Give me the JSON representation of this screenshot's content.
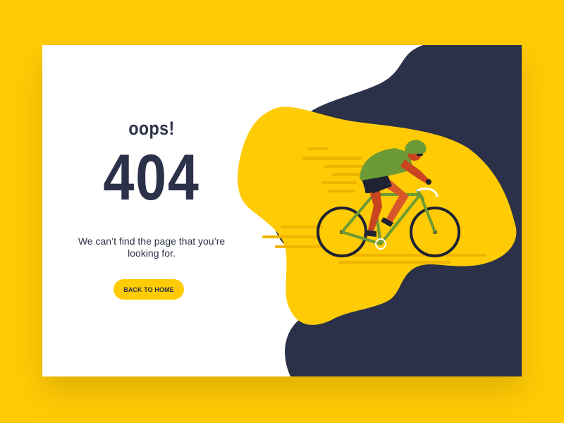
{
  "page": {
    "oops_text": "oops!",
    "error_code": "404",
    "message": "We can’t find the page that you’re looking for.",
    "back_button_label": "BACK TO HOME"
  },
  "colors": {
    "background": "#FFCB05",
    "card": "#FFFFFF",
    "navy": "#2B3148",
    "button": "#FFCB05"
  },
  "illustration": {
    "subject": "cyclist-on-road-bike"
  }
}
